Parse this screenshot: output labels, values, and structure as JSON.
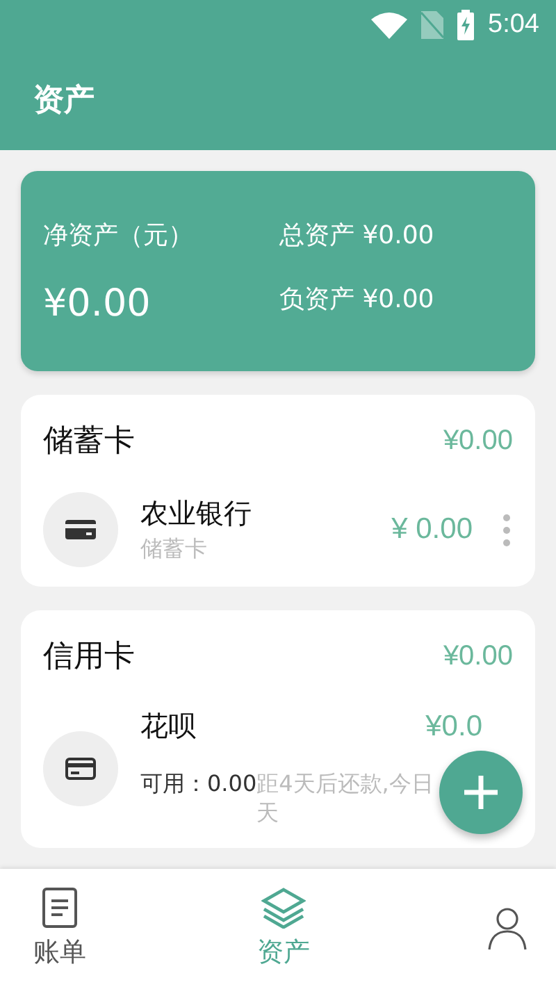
{
  "status_bar": {
    "time": "5:04"
  },
  "app_bar": {
    "title": "资产"
  },
  "summary": {
    "net_label": "净资产（元）",
    "net_value": "¥0.00",
    "total_label": "总资产 ¥0.00",
    "liability_label": "负资产 ¥0.00"
  },
  "sections": [
    {
      "title": "储蓄卡",
      "total": "¥0.00",
      "accounts": [
        {
          "kind": "debit",
          "name": "农业银行",
          "subtitle": "储蓄卡",
          "amount": "¥ 0.00"
        }
      ]
    },
    {
      "title": "信用卡",
      "total": "¥0.00",
      "accounts": [
        {
          "kind": "credit",
          "name": "花呗",
          "amount": "¥0.0",
          "available": "可用：0.00",
          "due": [
            "距4天后还款,今日",
            "天"
          ]
        }
      ]
    }
  ],
  "nav": [
    {
      "label": "账单",
      "selected": false,
      "kind": "bill"
    },
    {
      "label": "资产",
      "selected": true,
      "kind": "layers"
    },
    {
      "selected": false,
      "kind": "person"
    }
  ]
}
